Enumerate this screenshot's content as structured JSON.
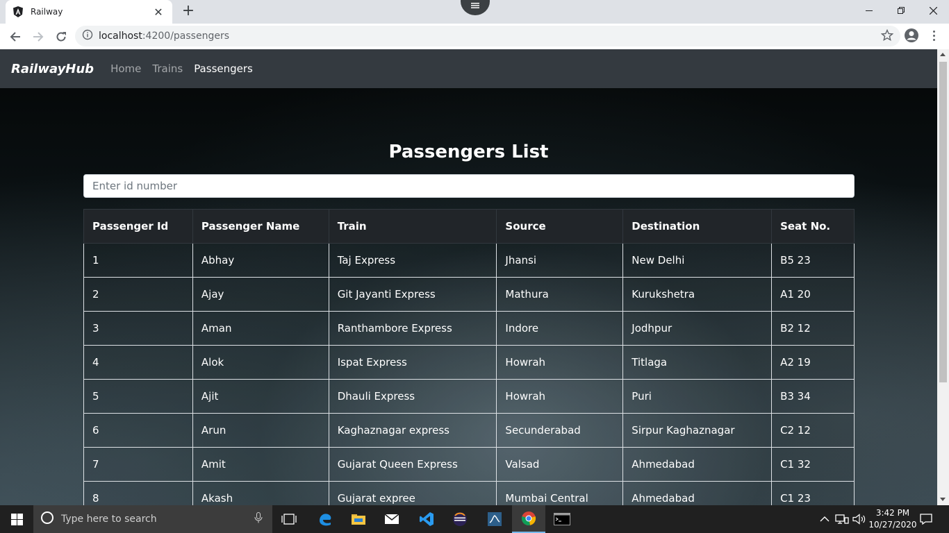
{
  "browser": {
    "tab_title": "Railway",
    "tab_close": "✕",
    "new_tab": "+",
    "url_host": "localhost",
    "url_path": ":4200/passengers"
  },
  "app": {
    "brand": "RailwayHub",
    "nav": [
      {
        "label": "Home"
      },
      {
        "label": "Trains"
      },
      {
        "label": "Passengers"
      }
    ],
    "page_title": "Passengers List",
    "search_placeholder": "Enter id number"
  },
  "table": {
    "columns": [
      "Passenger Id",
      "Passenger Name",
      "Train",
      "Source",
      "Destination",
      "Seat No."
    ],
    "rows": [
      [
        "1",
        "Abhay",
        "Taj Express",
        "Jhansi",
        "New Delhi",
        "B5 23"
      ],
      [
        "2",
        "Ajay",
        "Git Jayanti Express",
        "Mathura",
        "Kurukshetra",
        "A1 20"
      ],
      [
        "3",
        "Aman",
        "Ranthambore Express",
        "Indore",
        "Jodhpur",
        "B2 12"
      ],
      [
        "4",
        "Alok",
        "Ispat Express",
        "Howrah",
        "Titlaga",
        "A2 19"
      ],
      [
        "5",
        "Ajit",
        "Dhauli Express",
        "Howrah",
        "Puri",
        "B3 34"
      ],
      [
        "6",
        "Arun",
        "Kaghaznagar express",
        "Secunderabad",
        "Sirpur Kaghaznagar",
        "C2 12"
      ],
      [
        "7",
        "Amit",
        "Gujarat Queen Express",
        "Valsad",
        "Ahmedabad",
        "C1 32"
      ],
      [
        "8",
        "Akash",
        "Gujarat expree",
        "Mumbai Central",
        "Ahmedabad",
        "C1 23"
      ]
    ]
  },
  "taskbar": {
    "search_placeholder": "Type here to search",
    "time": "3:42 PM",
    "date": "10/27/2020"
  },
  "colors": {
    "navbar": "#343a40",
    "table_header": "#212529",
    "taskbar": "#202020"
  }
}
